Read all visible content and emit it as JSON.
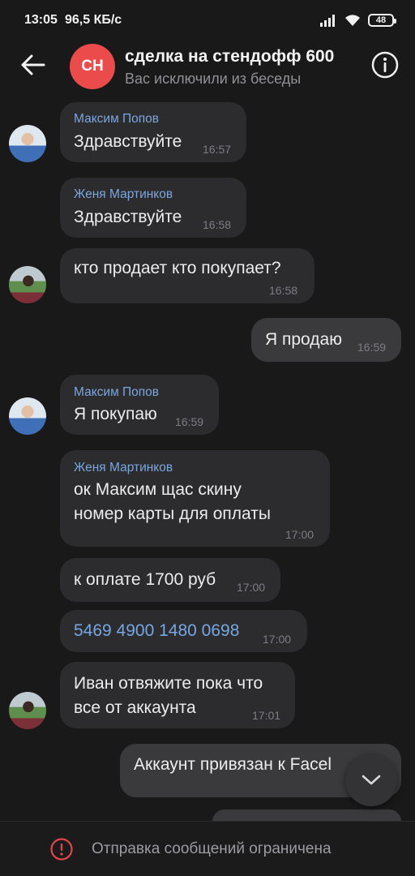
{
  "status_bar": {
    "time": "13:05",
    "net_speed": "96,5 КБ/с",
    "battery": "48"
  },
  "header": {
    "avatar_initials": "СН",
    "avatar_color": "#eb4b4b",
    "title": "сделка на стендофф 600",
    "subtitle": "Вас исключили из беседы"
  },
  "messages": [
    {
      "sender": "Максим Попов",
      "lines": [
        "Здравствуйте"
      ],
      "time": "16:57"
    },
    {
      "sender": "Женя Мартинков",
      "lines": [
        "Здравствуйте"
      ],
      "time": "16:58"
    },
    {
      "sender": "",
      "lines": [
        "кто продает кто покупает?"
      ],
      "time": "16:58"
    },
    {
      "sender": "",
      "lines": [
        "Я продаю"
      ],
      "time": "16:59",
      "outgoing": true
    },
    {
      "sender": "Максим Попов",
      "lines": [
        "Я покупаю"
      ],
      "time": "16:59"
    },
    {
      "sender": "Женя Мартинков",
      "lines": [
        "ок Максим щас скину",
        "номер карты для оплаты"
      ],
      "time": "17:00"
    },
    {
      "sender": "",
      "lines": [
        "к оплате 1700 руб"
      ],
      "time": "17:00"
    },
    {
      "sender": "",
      "lines": [
        "5469 4900 1480 0698"
      ],
      "time": "17:00",
      "link": true
    },
    {
      "sender": "",
      "lines": [
        "Иван отвяжите пока что",
        "все от аккаунта"
      ],
      "time": "17:01"
    },
    {
      "sender": "",
      "lines": [
        "Аккаунт привязан к Facel"
      ],
      "time": "",
      "outgoing": true
    }
  ],
  "bottom_bar": {
    "restriction_text": "Отправка сообщений ограничена",
    "warning_color": "#e0454a"
  },
  "colors": {
    "background": "#19191a",
    "incoming_bubble": "#2c2c2e",
    "outgoing_bubble": "#3a3a3c",
    "sender_name": "#7aa6dc",
    "link": "#77a7e2"
  },
  "icons": [
    "back-arrow-icon",
    "info-icon",
    "scroll-down-icon",
    "warning-icon",
    "wifi-icon",
    "signal-icon",
    "battery-icon"
  ]
}
